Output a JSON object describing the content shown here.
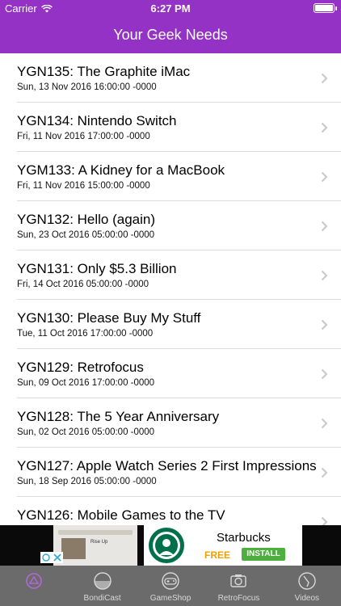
{
  "status_bar": {
    "carrier": "Carrier",
    "time": "6:27 PM"
  },
  "nav": {
    "title": "Your Geek Needs"
  },
  "colors": {
    "accent": "#9532c6",
    "tabbar": "#6b6b6b"
  },
  "episodes": [
    {
      "title": "YGN135: The Graphite iMac",
      "date": "Sun, 13 Nov 2016 16:00:00 -0000"
    },
    {
      "title": "YGN134: Nintendo Switch",
      "date": "Fri, 11 Nov 2016 17:00:00 -0000"
    },
    {
      "title": "YGM133: A Kidney for a MacBook",
      "date": "Fri, 11 Nov 2016 15:00:00 -0000"
    },
    {
      "title": "YGN132: Hello (again)",
      "date": "Sun, 23 Oct 2016 05:00:00 -0000"
    },
    {
      "title": "YGN131: Only $5.3 Billion",
      "date": "Fri, 14 Oct 2016 05:00:00 -0000"
    },
    {
      "title": "YGN130: Please Buy My Stuff",
      "date": "Tue, 11 Oct 2016 17:00:00 -0000"
    },
    {
      "title": "YGN129: Retrofocus",
      "date": "Sun, 09 Oct 2016 17:00:00 -0000"
    },
    {
      "title": "YGN128: The 5 Year Anniversary",
      "date": "Sun, 02 Oct 2016 05:00:00 -0000"
    },
    {
      "title": "YGN127: Apple Watch Series 2 First Impressions",
      "date": "Sun, 18 Sep 2016 05:00:00 -0000"
    },
    {
      "title": "YGN126: Mobile Games to the TV",
      "date": ""
    }
  ],
  "ad": {
    "brand": "Starbucks",
    "free": "FREE",
    "install": "INSTALL",
    "small_text": "Rise Up"
  },
  "tabs": [
    {
      "label": "",
      "icon": "ygn-icon",
      "active": true
    },
    {
      "label": "BondiCast",
      "icon": "bondicast-icon",
      "active": false
    },
    {
      "label": "GameShop",
      "icon": "gamepad-icon",
      "active": false
    },
    {
      "label": "RetroFocus",
      "icon": "camera-icon",
      "active": false
    },
    {
      "label": "Videos",
      "icon": "video-icon",
      "active": false
    }
  ]
}
